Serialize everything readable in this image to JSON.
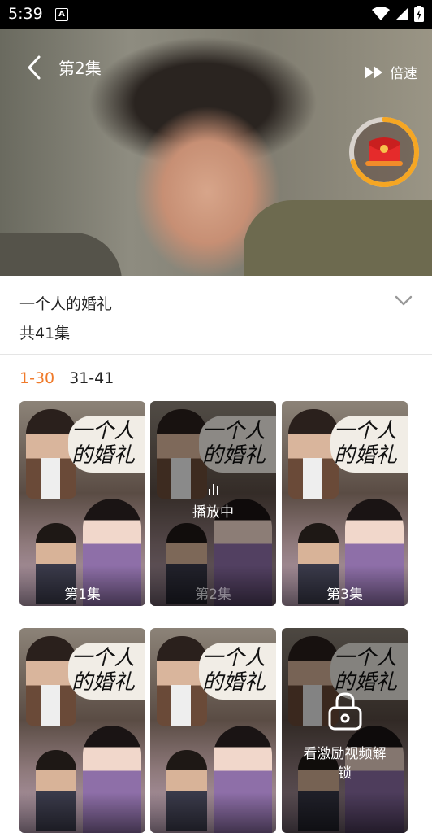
{
  "status_bar": {
    "time": "5:39",
    "notif_badge": "A"
  },
  "player": {
    "back_icon": "chevron-left-icon",
    "episode_title": "第2集",
    "speed_label": "倍速",
    "speed_icon": "fast-forward-icon",
    "reward_icon": "red-envelope-icon",
    "reward_progress": 0.7
  },
  "drama": {
    "name": "一个人的婚礼",
    "episode_count": "共41集"
  },
  "ranges": [
    {
      "label": "1-30",
      "active": true
    },
    {
      "label": "31-41",
      "active": false
    }
  ],
  "episodes": {
    "poster_title": "一个人的婚礼",
    "items": [
      {
        "label": "第1集"
      },
      {
        "label": "第2集",
        "playing_text": "播放中"
      },
      {
        "label": "第3集"
      },
      {
        "label": ""
      },
      {
        "label": ""
      },
      {
        "label": "",
        "locked_text": "看激励视频解锁"
      }
    ]
  },
  "colors": {
    "accent": "#f07a2a",
    "reward_ring": "#f5a623"
  }
}
